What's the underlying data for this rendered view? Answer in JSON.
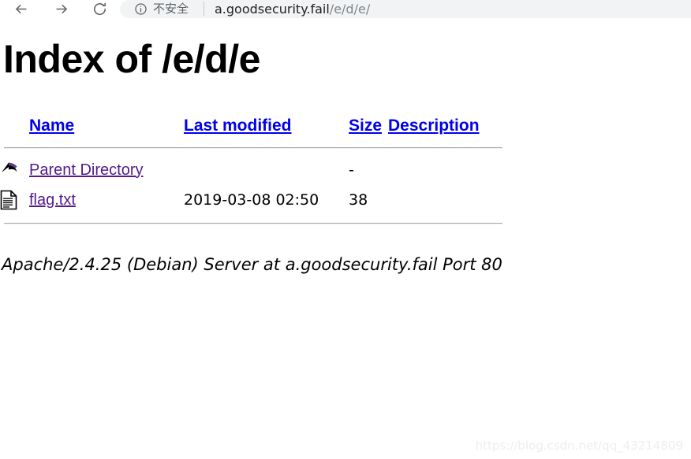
{
  "browser": {
    "back_icon": "arrow-left-icon",
    "forward_icon": "arrow-right-icon",
    "reload_icon": "reload-icon",
    "security": {
      "icon": "info-circle-icon",
      "label": "不安全",
      "separator": "|"
    },
    "url": {
      "host": "a.goodsecurity.fail",
      "path": "/e/d/e/",
      "full": "a.goodsecurity.fail/e/d/e/"
    }
  },
  "page": {
    "title": "Index of /e/d/e",
    "headers": {
      "name": "Name",
      "last_modified": "Last modified",
      "size": "Size",
      "description": "Description"
    },
    "entries": [
      {
        "icon": "parent-directory-icon",
        "name": "Parent Directory",
        "last_modified": "",
        "size": "-",
        "description": ""
      },
      {
        "icon": "text-file-icon",
        "name": "flag.txt",
        "last_modified": "2019-03-08 02:50",
        "size": "38",
        "description": ""
      }
    ],
    "server_signature": "Apache/2.4.25 (Debian) Server at a.goodsecurity.fail Port 80"
  },
  "watermark": {
    "text": "https://blog.csdn.net/qq_43214809"
  },
  "colors": {
    "link": "#0000EE",
    "visited_link": "#551A8B",
    "chrome_bg": "#F1F3F4",
    "url_host": "#202124",
    "url_path": "#80868B"
  }
}
